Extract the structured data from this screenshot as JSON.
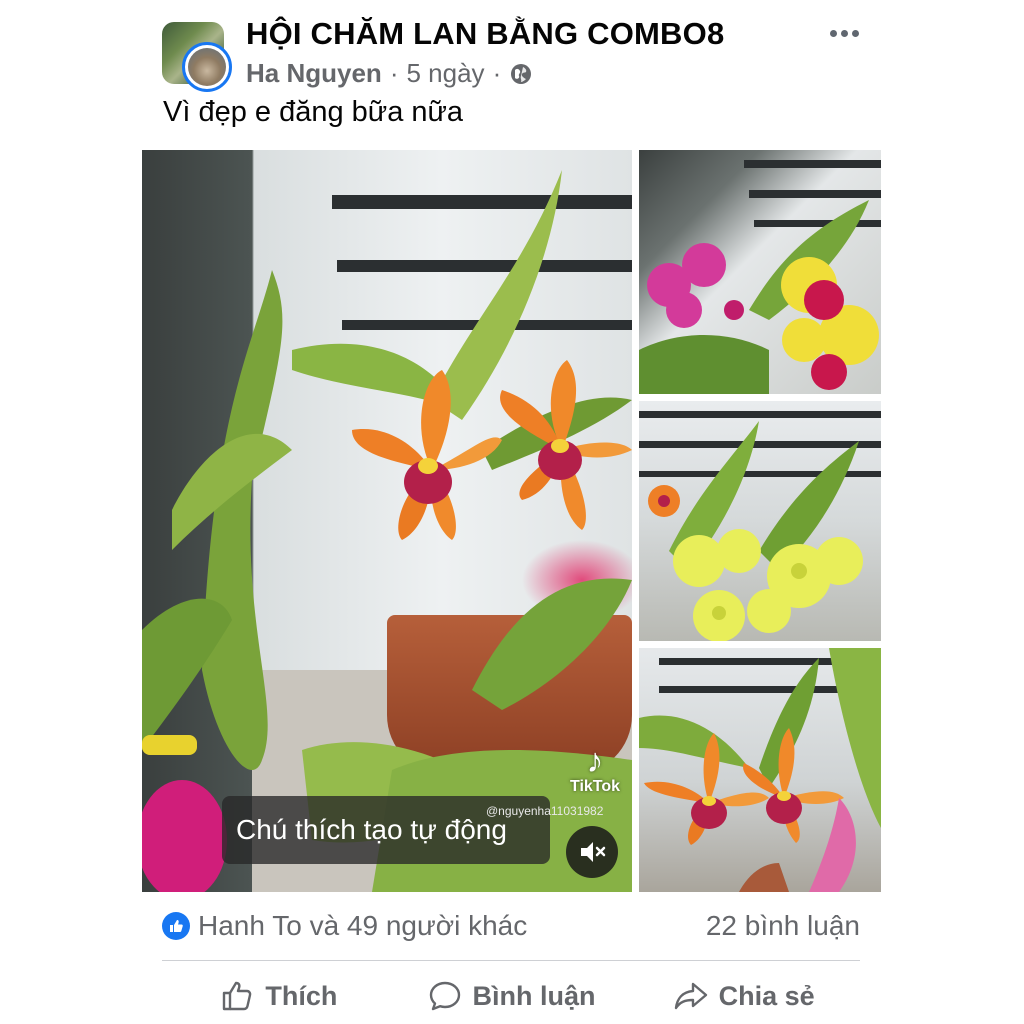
{
  "post": {
    "group_name": "HỘI CHĂM LAN BẰNG COMBO8",
    "author": "Ha Nguyen",
    "separator_1": "·",
    "time": "5 ngày",
    "separator_2": "·",
    "text": "Vì đẹp e đăng bữa nữa"
  },
  "media": {
    "caption": "Chú thích tạo tự động",
    "tiktok_label": "TikTok",
    "tiktok_handle": "@nguyenha11031982"
  },
  "engagement": {
    "reactions_text": "Hanh To và 49 người khác",
    "comments_text": "22 bình luận"
  },
  "actions": {
    "like": "Thích",
    "comment": "Bình luận",
    "share": "Chia sẻ"
  },
  "colors": {
    "accent": "#1877f2",
    "secondary_text": "#65676b"
  },
  "icons": [
    "globe-icon",
    "more-icon",
    "tiktok-icon",
    "mute-icon",
    "like-reaction-icon",
    "thumbs-up-icon",
    "comment-icon",
    "share-icon"
  ]
}
